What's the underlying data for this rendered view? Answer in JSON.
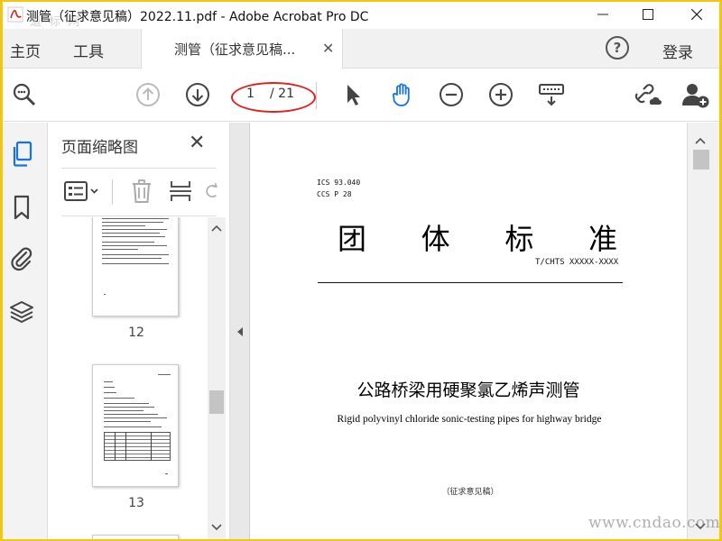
{
  "window": {
    "title": "测管（征求意见稿）2022.11.pdf - Adobe Acrobat Pro DC",
    "watermark_top": "道 标 网"
  },
  "menubar": {
    "home": "主页",
    "tools": "工具",
    "doc_tab": "测管（征求意见稿...",
    "help": "?",
    "login": "登录"
  },
  "toolbar": {
    "page_current": "1",
    "page_total": "/ 21"
  },
  "thumbnails": {
    "title": "页面缩略图",
    "pages": [
      {
        "label": "12"
      },
      {
        "label": "13"
      }
    ]
  },
  "document": {
    "ics": "ICS 93.040",
    "ccs": "CCS P 28",
    "heading_chars": [
      "团",
      "体",
      "标",
      "准"
    ],
    "standard_code": "T/CHTS XXXXX-XXXX",
    "title_cn": "公路桥梁用硬聚氯乙烯声测管",
    "title_en": "Rigid polyvinyl chloride sonic-testing pipes for highway bridge",
    "draft_note": "（征求意见稿）"
  },
  "watermark_bottom": "www.cndao.com",
  "colors": {
    "frame": "#f2c80f",
    "accent_blue": "#1473e6",
    "annotation_red": "#e02020"
  }
}
